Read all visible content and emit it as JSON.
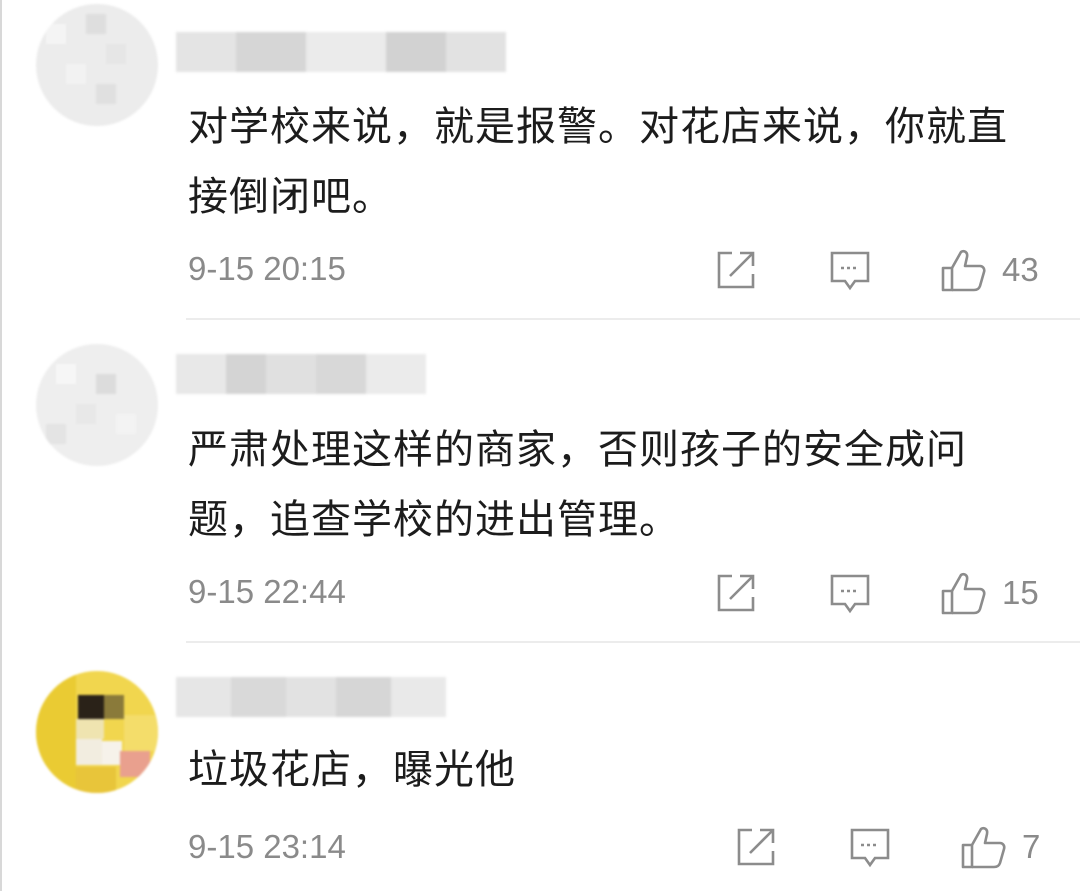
{
  "comments": [
    {
      "text": "对学校来说，就是报警。对花店来说，你就直接倒闭吧。",
      "timestamp": "9-15 20:15",
      "likes": "43",
      "avatar_icon": "pixelated-avatar-icon"
    },
    {
      "text": "严肃处理这样的商家，否则孩子的安全成问题，追查学校的进出管理。",
      "timestamp": "9-15 22:44",
      "likes": "15",
      "avatar_icon": "pixelated-avatar-icon"
    },
    {
      "text": "垃圾花店，曝光他",
      "timestamp": "9-15 23:14",
      "likes": "7",
      "avatar_icon": "pixelated-avatar-icon"
    }
  ],
  "icons": {
    "share": "share-icon",
    "reply": "comment-icon",
    "like": "thumbs-up-icon"
  },
  "colors": {
    "text": "#1c1c1c",
    "meta": "#8a8a8a",
    "icon": "#8c8c8c",
    "divider": "#ececec"
  }
}
